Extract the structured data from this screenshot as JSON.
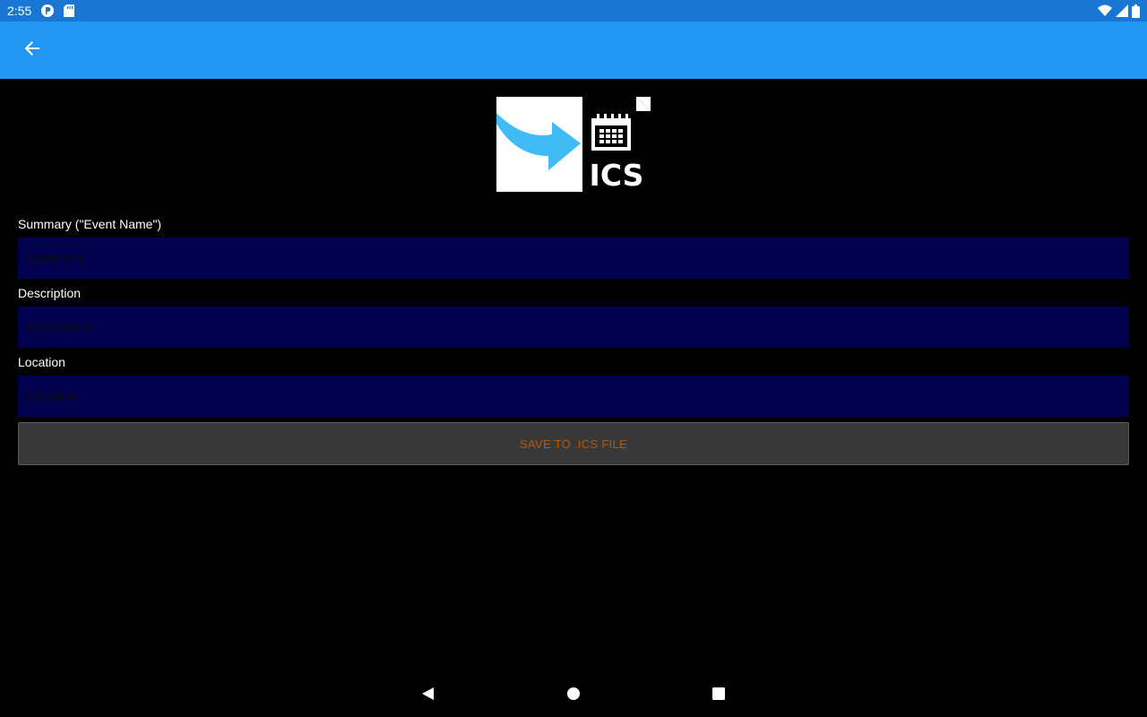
{
  "status_bar": {
    "time": "2:55",
    "left_icons": [
      "notification-p-icon",
      "sd-card-icon"
    ],
    "right_icons": [
      "wifi-icon",
      "cell-signal-icon",
      "battery-icon"
    ]
  },
  "app_bar": {
    "back_icon": "arrow-back-icon",
    "color": "#2196F3"
  },
  "logo": {
    "text": "ICS"
  },
  "form": {
    "summary": {
      "label": "Summary (\"Event Name\")",
      "placeholder": "Summary",
      "value": ""
    },
    "description": {
      "label": "Description",
      "placeholder": "Description",
      "value": ""
    },
    "location": {
      "label": "Location",
      "placeholder": "Location",
      "value": ""
    },
    "save_label": "SAVE TO .ICS FILE"
  },
  "nav_bar": {
    "icons": [
      "back-triangle-icon",
      "home-circle-icon",
      "recents-square-icon"
    ]
  }
}
